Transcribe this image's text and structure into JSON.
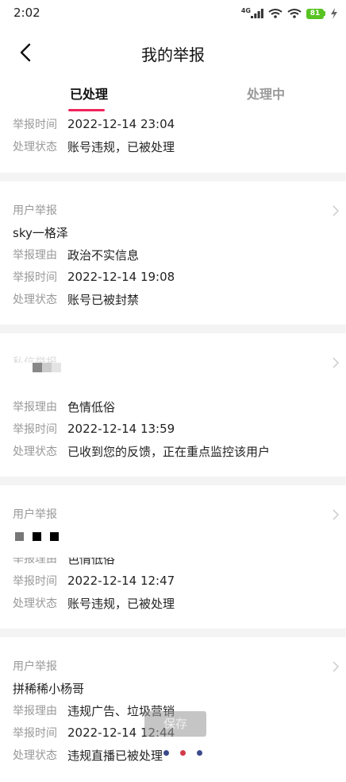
{
  "status_bar": {
    "time": "2:02",
    "network": "4G",
    "battery": "81"
  },
  "nav": {
    "title": "我的举报"
  },
  "tabs": [
    {
      "label": "已处理",
      "active": true
    },
    {
      "label": "处理中",
      "active": false
    }
  ],
  "cards": [
    {
      "rows": [
        {
          "label": "举报时间",
          "value": "2022-12-14 23:04"
        },
        {
          "label": "处理状态",
          "value": "账号违规，已被处理"
        }
      ]
    },
    {
      "type": "用户举报",
      "user": "sky一格泽",
      "rows": [
        {
          "label": "举报理由",
          "value": "政治不实信息"
        },
        {
          "label": "举报时间",
          "value": "2022-12-14 19:08"
        },
        {
          "label": "处理状态",
          "value": "账号已被封禁"
        }
      ]
    },
    {
      "type": "私信举报",
      "rows": [
        {
          "label": "举报理由",
          "value": "色情低俗"
        },
        {
          "label": "举报时间",
          "value": "2022-12-14 13:59"
        },
        {
          "label": "处理状态",
          "value": "已收到您的反馈，正在重点监控该用户"
        }
      ]
    },
    {
      "type": "用户举报",
      "rows": [
        {
          "label": "举报理由",
          "value": "色情低俗"
        },
        {
          "label": "举报时间",
          "value": "2022-12-14 12:47"
        },
        {
          "label": "处理状态",
          "value": "账号违规，已被处理"
        }
      ]
    },
    {
      "type": "用户举报",
      "user": "拼稀稀小杨哥",
      "rows": [
        {
          "label": "举报理由",
          "value": "违规广告、垃圾营销"
        },
        {
          "label": "举报时间",
          "value": "2022-12-14 12:44"
        },
        {
          "label": "处理状态",
          "value": "违规直播已被处理"
        }
      ]
    }
  ],
  "overlay": {
    "save_label": "保存"
  },
  "colors": {
    "accent": "#f0245a",
    "battery": "#58c322",
    "separator": "#f4f4f4"
  }
}
